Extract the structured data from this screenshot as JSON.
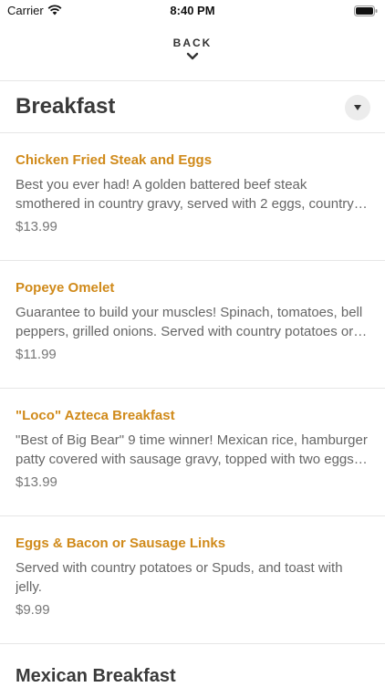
{
  "status_bar": {
    "carrier": "Carrier",
    "time": "8:40 PM"
  },
  "header": {
    "back_label": "BACK"
  },
  "section": {
    "title": "Breakfast"
  },
  "items": [
    {
      "name": "Chicken Fried Steak and Eggs",
      "description": "Best you ever had! A golden battered beef steak smothered in country gravy, served with 2 eggs, country potatoes, and toast.",
      "price": "$13.99"
    },
    {
      "name": "Popeye Omelet",
      "description": "Guarantee to build your muscles! Spinach, tomatoes, bell peppers, grilled onions. Served with country potatoes or Spuds, and toast.",
      "price": "$11.99"
    },
    {
      "name": "\"Loco\" Azteca Breakfast",
      "description": "\"Best of Big Bear\" 9 time winner! Mexican rice, hamburger patty covered with sausage gravy, topped with two eggs and cheese.",
      "price": "$13.99"
    },
    {
      "name": "Eggs & Bacon or Sausage Links",
      "description": "Served with country potatoes or Spuds, and toast with jelly.",
      "price": "$9.99"
    }
  ],
  "next_section": {
    "title": "Mexican Breakfast"
  },
  "colors": {
    "item_name": "#d08a1a",
    "divider": "#e6e6e6"
  }
}
